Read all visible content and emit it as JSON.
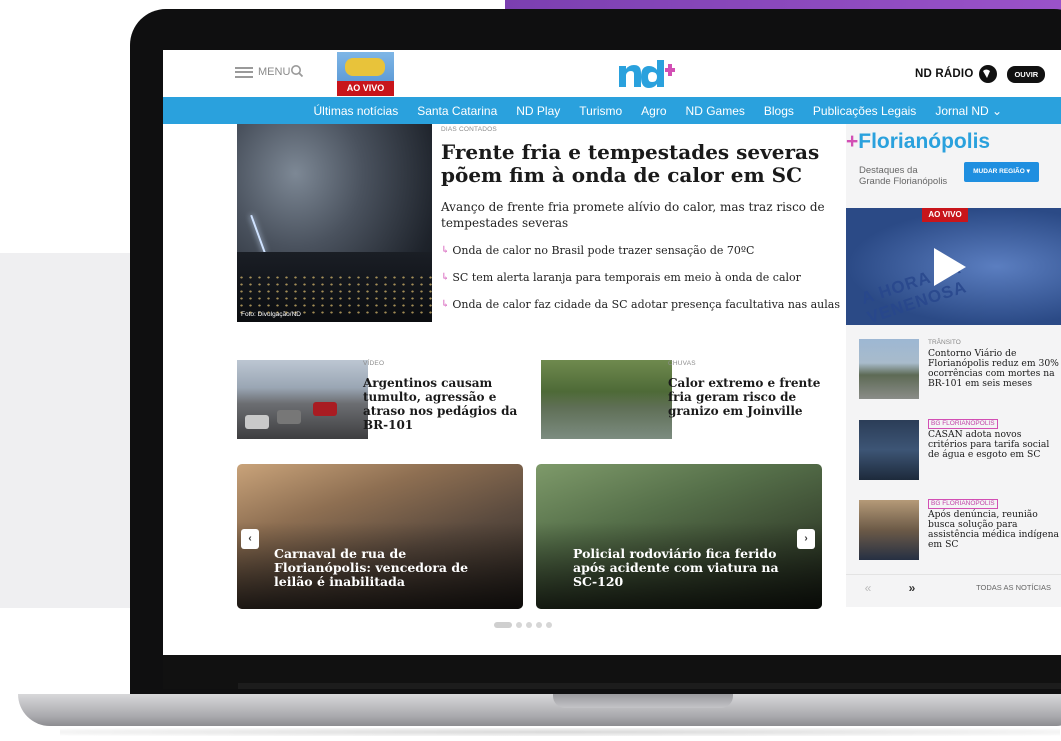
{
  "header": {
    "menu_label": "MENU",
    "promo_live_label": "AO VIVO",
    "logo_text": "nd+",
    "radio_label": "ND RÁDIO",
    "listen_label": "OUVIR"
  },
  "nav": {
    "items": [
      "Últimas notícias",
      "Santa Catarina",
      "ND Play",
      "Turismo",
      "Agro",
      "ND Games",
      "Blogs",
      "Publicações Legais",
      "Jornal ND ⌄"
    ]
  },
  "main_story": {
    "kicker": "DIAS CONTADOS",
    "title": "Frente fria e tempestades severas põem fim à onda de calor em SC",
    "subtitle": "Avanço de frente fria promete alívio do calor, mas traz risco de tempestades severas",
    "image_credit": "Foto: Divulgação/ND",
    "related": [
      "Onda de calor no Brasil pode trazer sensação de 70ºC",
      "SC tem alerta laranja para temporais em meio à onda de calor",
      "Onda de calor faz cidade da SC adotar presença facultativa nas aulas"
    ]
  },
  "secondary": [
    {
      "kicker": "VÍDEO",
      "title": "Argentinos causam tumulto, agressão e atraso nos pedágios da BR-101"
    },
    {
      "kicker": "CHUVAS",
      "title": "Calor extremo e frente fria geram risco de granizo em Joinville"
    }
  ],
  "carousel": {
    "cards": [
      {
        "title": "Carnaval de rua de Florianópolis: vencedora de leilão é inabilitada"
      },
      {
        "title": "Policial rodoviário fica ferido após acidente com viatura na SC-120"
      }
    ],
    "prev_label": "‹",
    "next_label": "›",
    "active_index": 0,
    "dot_count": 5
  },
  "sidebar": {
    "city_plus": "+",
    "city": "Florianópolis",
    "highlights": "Destaques da Grande Florianópolis",
    "change_region": "MUDAR REGIÃO ▾",
    "video_live": "AO VIVO",
    "video_text": "A HORA DA VENENOSA",
    "items": [
      {
        "tag": "TRÂNSITO",
        "title": "Contorno Viário de Florianópolis reduz em 30% ocorrências com mortes na BR-101 em seis meses"
      },
      {
        "tag": "BG FLORIANÓPOLIS",
        "title": "CASAN adota novos critérios para tarifa social de água e esgoto em SC"
      },
      {
        "tag": "BG FLORIANÓPOLIS",
        "title": "Após denúncia, reunião busca solução para assistência médica indígena em SC"
      }
    ],
    "pager_prev": "«",
    "pager_next": "»",
    "all_news": "TODAS AS NOTÍCIAS"
  },
  "colors": {
    "accent_blue": "#2aa1dd",
    "accent_pink": "#d24fb4",
    "live_red": "#c8151b"
  }
}
